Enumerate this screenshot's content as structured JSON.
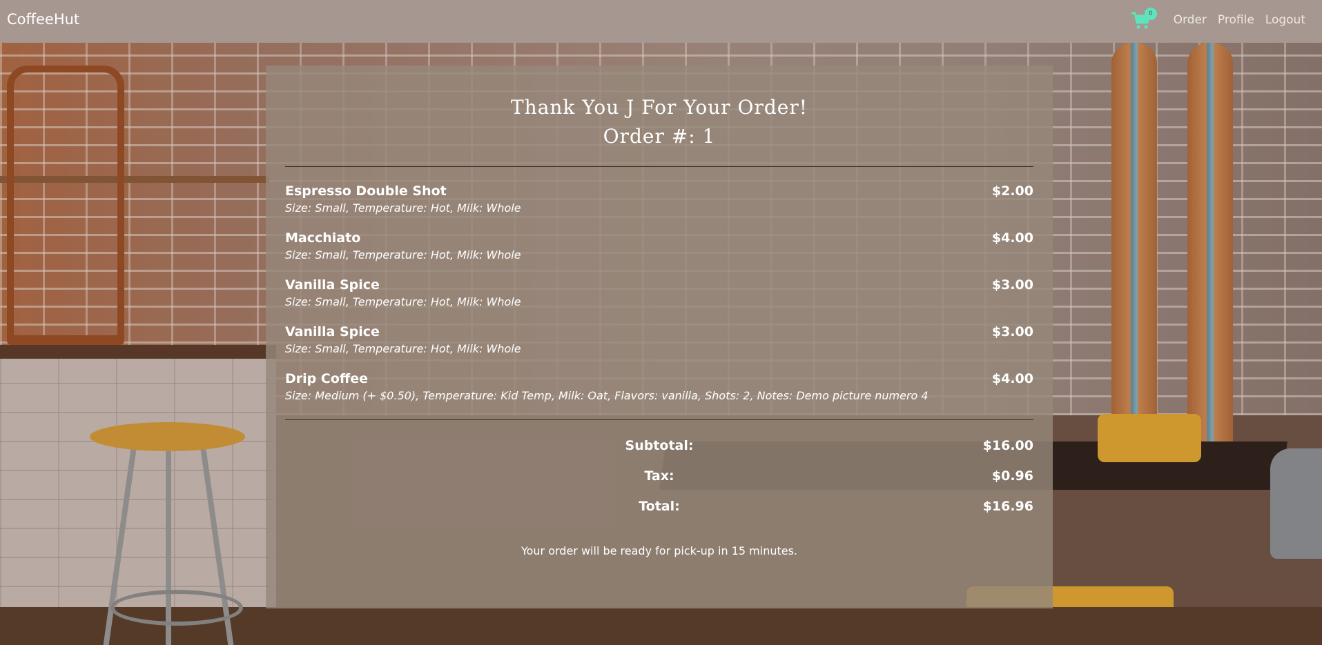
{
  "navbar": {
    "brand": "CoffeeHut",
    "cart_count": "0",
    "links": [
      "Order",
      "Profile",
      "Logout"
    ]
  },
  "order": {
    "thank_you": "Thank You J For Your Order!",
    "order_number": "Order #: 1",
    "items": [
      {
        "name": "Espresso Double Shot",
        "details": "Size: Small, Temperature: Hot, Milk: Whole",
        "price": "$2.00"
      },
      {
        "name": "Macchiato",
        "details": "Size: Small, Temperature: Hot, Milk: Whole",
        "price": "$4.00"
      },
      {
        "name": "Vanilla Spice",
        "details": "Size: Small, Temperature: Hot, Milk: Whole",
        "price": "$3.00"
      },
      {
        "name": "Vanilla Spice",
        "details": "Size: Small, Temperature: Hot, Milk: Whole",
        "price": "$3.00"
      },
      {
        "name": "Drip Coffee",
        "details": "Size: Medium (+ $0.50), Temperature: Kid Temp, Milk: Oat, Flavors: vanilla, Shots: 2, Notes: Demo picture numero 4",
        "price": "$4.00"
      }
    ],
    "totals": {
      "subtotal_label": "Subtotal:",
      "subtotal": "$16.00",
      "tax_label": "Tax:",
      "tax": "$0.96",
      "total_label": "Total:",
      "total": "$16.96"
    },
    "pickup_message": "Your order will be ready for pick-up in 15 minutes."
  },
  "colors": {
    "navbar_bg": "#a69790",
    "cart_icon": "#5ee3bc",
    "card_bg": "rgba(150,135,122,0.82)"
  }
}
